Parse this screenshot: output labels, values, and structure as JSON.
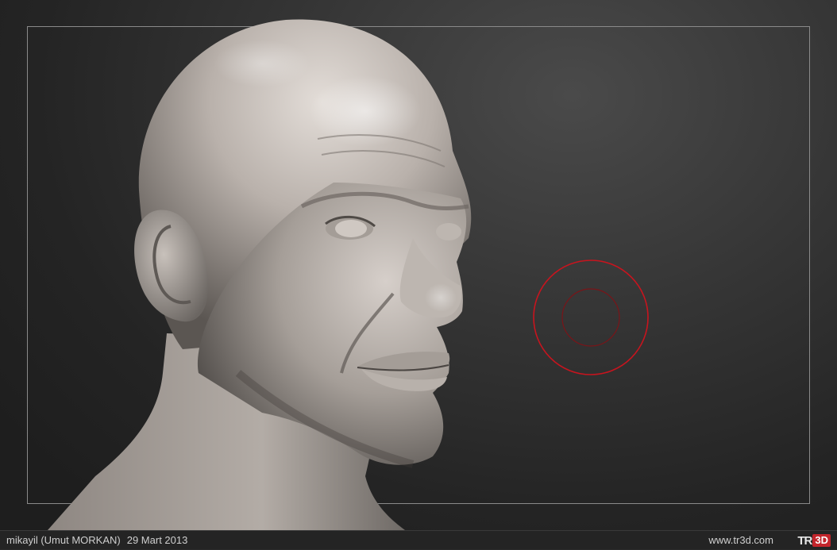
{
  "footer": {
    "author": "mikayil (Umut MORKAN)",
    "date": "29 Mart 2013",
    "site": "www.tr3d.com",
    "logo_text": "TR3D"
  },
  "colors": {
    "background": "#2a2a2a",
    "frame": "#8a8a8a",
    "brush_cursor": "#c8141e",
    "sculpt_clay": "#b9b1ab",
    "logo_accent": "#c3252c"
  },
  "icons": {
    "brush_cursor": "brush-cursor-icon",
    "logo": "tr3d-logo-icon"
  }
}
